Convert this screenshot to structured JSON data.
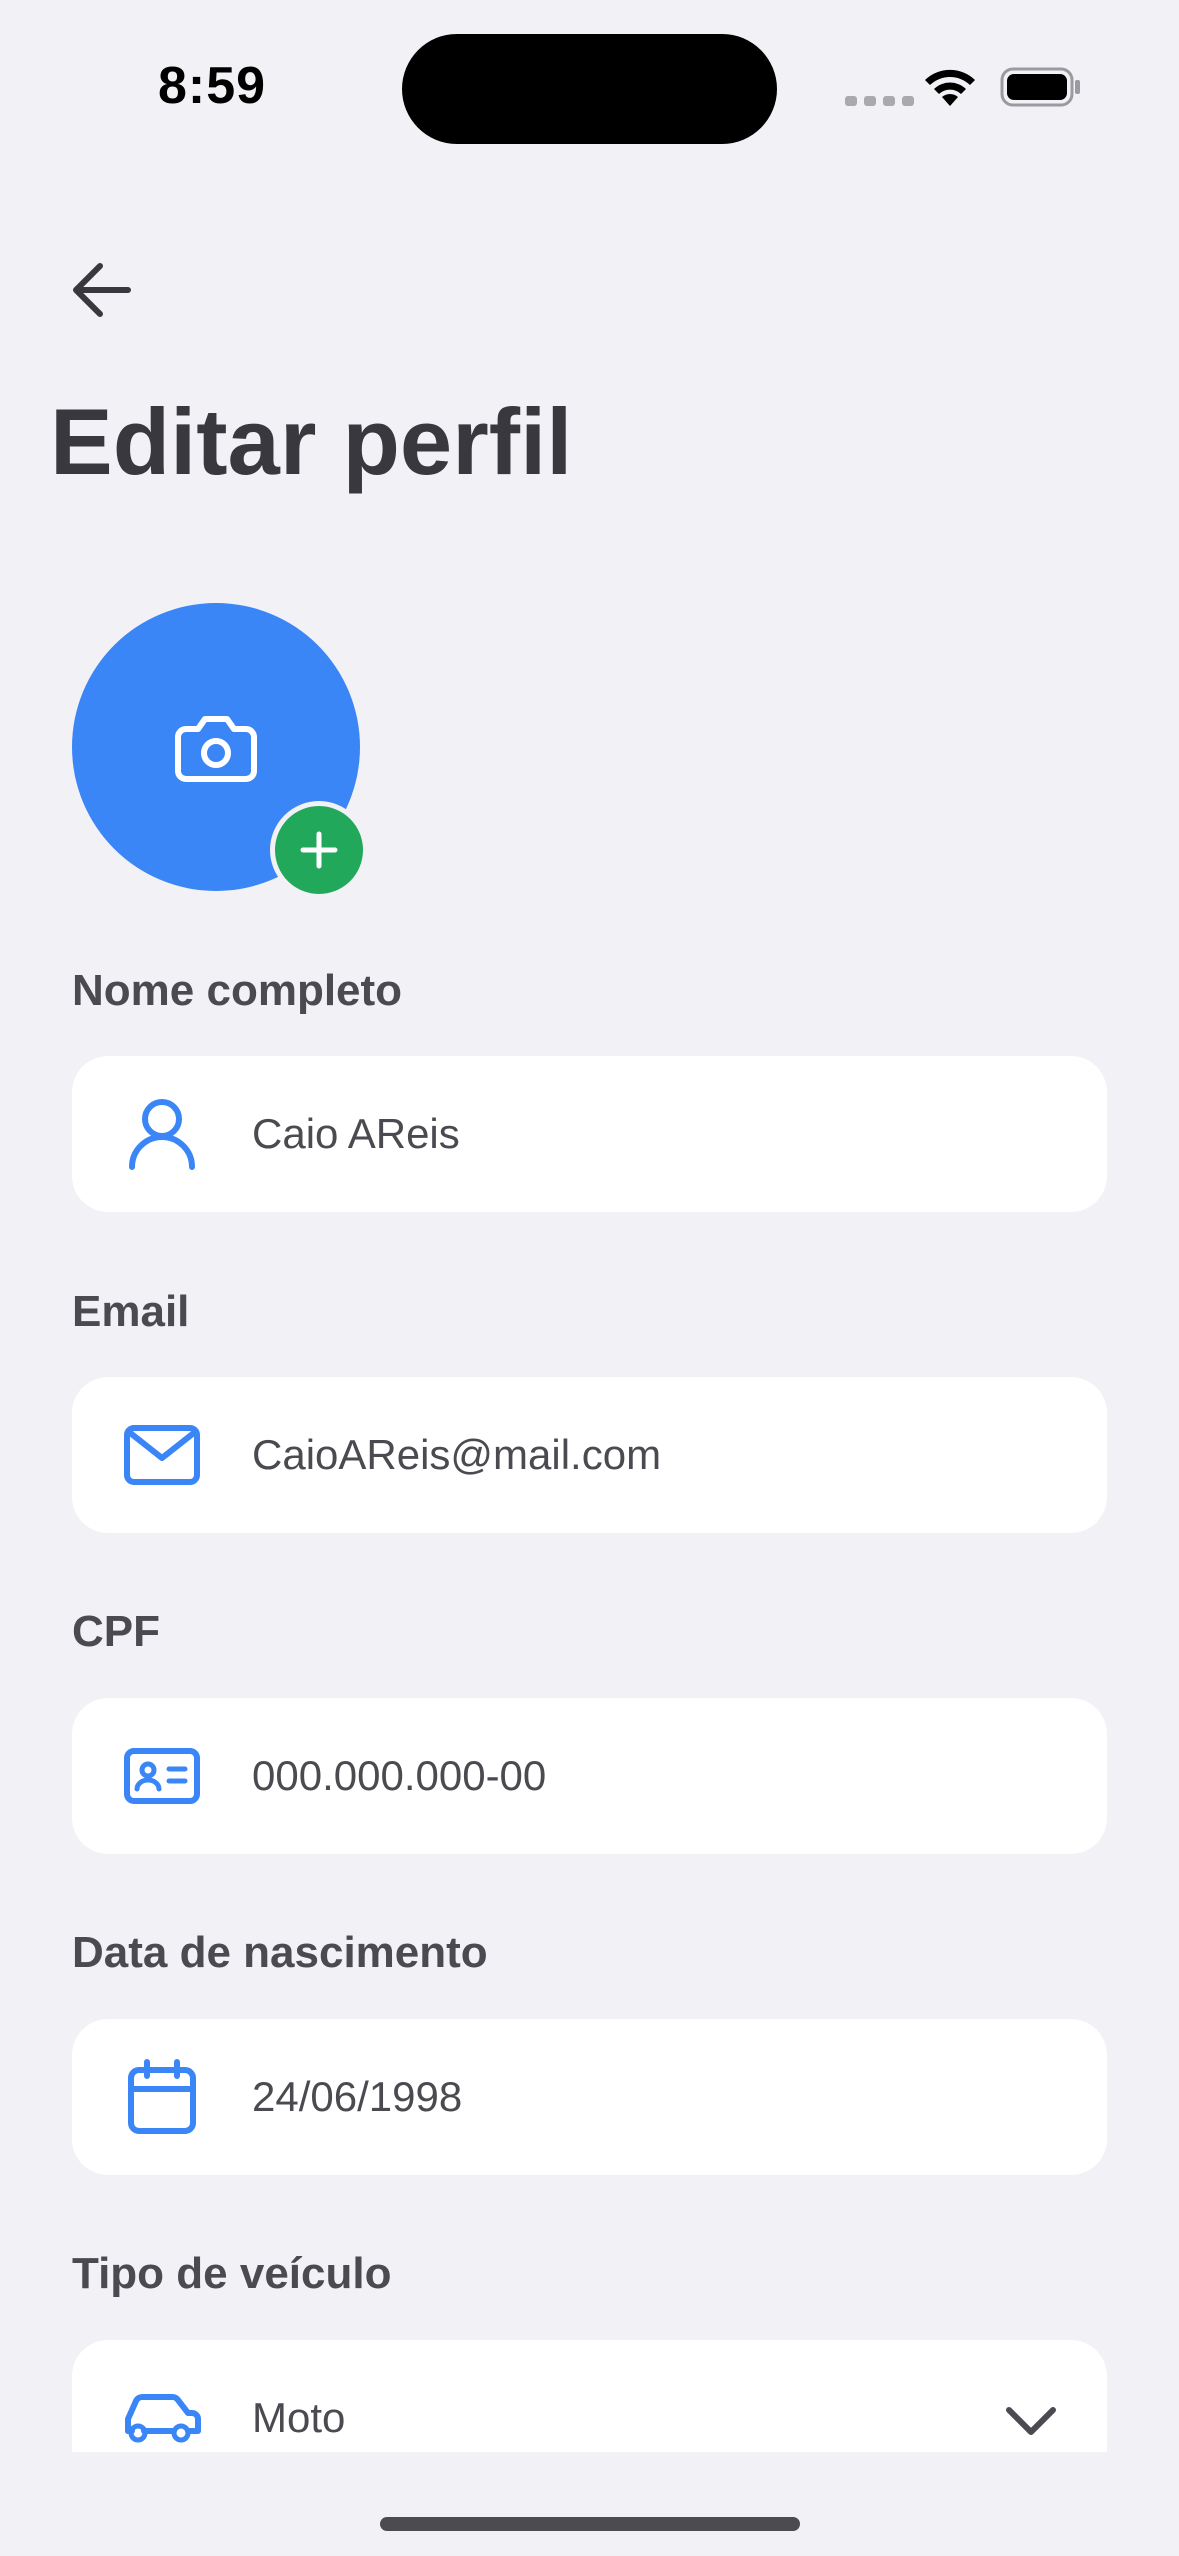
{
  "status_bar": {
    "time": "8:59"
  },
  "header": {
    "back_icon": "arrow-left-icon",
    "title": "Editar perfil"
  },
  "avatar": {
    "icon": "camera-icon",
    "badge_icon": "plus-icon",
    "color": "#3B86F7",
    "badge_color": "#22A85A"
  },
  "fields": [
    {
      "label": "Nome completo",
      "value": "Caio AReis",
      "icon": "user-icon"
    },
    {
      "label": "Email",
      "value": "CaioAReis@mail.com",
      "icon": "mail-icon"
    },
    {
      "label": "CPF",
      "value": "000.000.000-00",
      "icon": "id-card-icon"
    },
    {
      "label": "Data de nascimento",
      "value": "24/06/1998",
      "icon": "calendar-icon"
    },
    {
      "label": "Tipo de veículo",
      "value": "Moto",
      "icon": "car-icon",
      "dropdown": true
    }
  ],
  "colors": {
    "background": "#F1F1F6",
    "accent": "#3B86F7",
    "text": "#3A3A40"
  }
}
